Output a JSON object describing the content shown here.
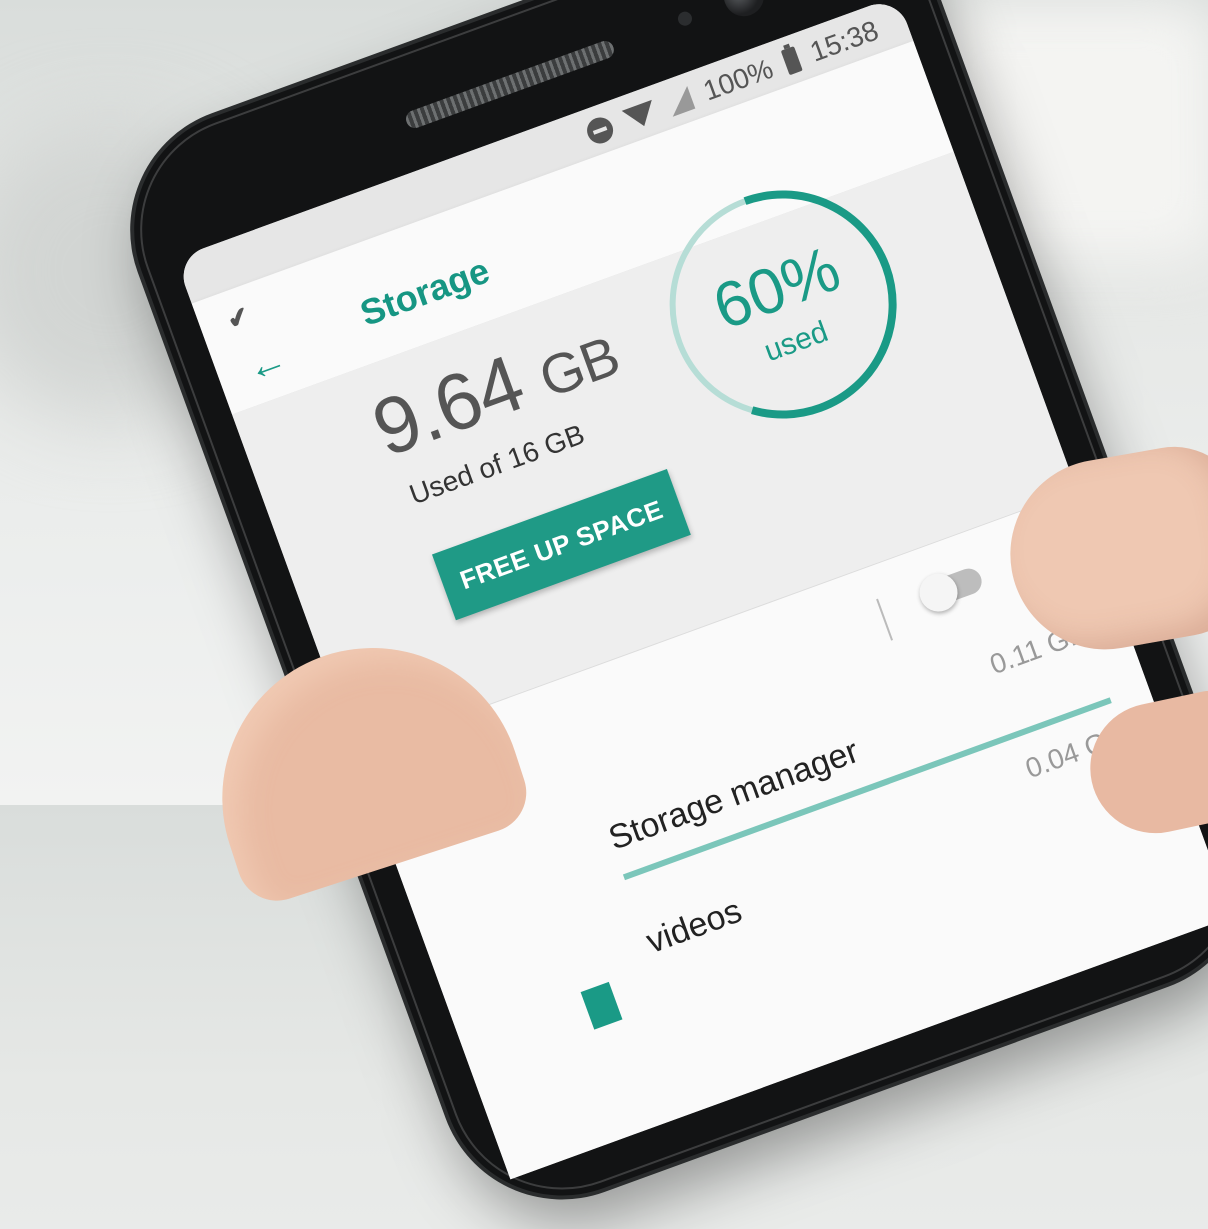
{
  "status_bar": {
    "battery_text": "100%",
    "time": "15:38",
    "icons": [
      "do-not-disturb-icon",
      "wifi-icon",
      "signal-icon",
      "battery-charging-icon"
    ]
  },
  "app_bar": {
    "title": "Storage",
    "back_icon": "arrow-left-icon",
    "logo_icon": "app-logo-icon"
  },
  "summary": {
    "used_value": "9.64",
    "used_unit": "GB",
    "used_of": "Used of 16 GB",
    "free_button_label": "FREE UP SPACE",
    "percent_text": "60%",
    "percent_label": "used",
    "percent_value": 0.6
  },
  "list": {
    "storage_manager": {
      "label": "Storage manager",
      "size": "0.11 GB",
      "toggle_on": false
    },
    "rows": [
      {
        "label": "videos",
        "size": "0.04 GB",
        "usage_fraction": 0.02
      }
    ]
  },
  "colors": {
    "accent": "#1a9a86",
    "accent_light": "#7bc6ba",
    "screen_bg": "#efefef"
  }
}
